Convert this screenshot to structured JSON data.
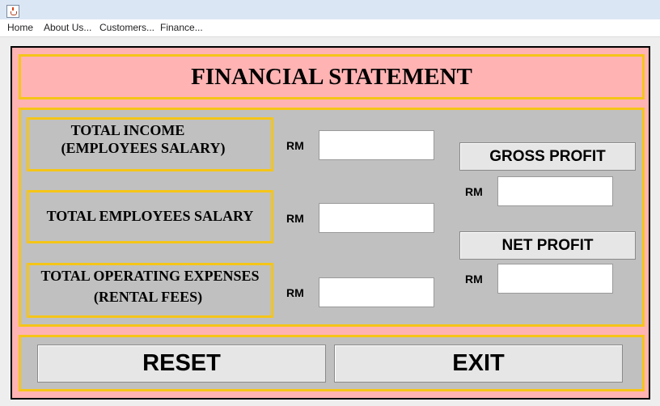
{
  "window": {
    "icon": "java-cup-icon"
  },
  "menu": {
    "items": [
      "Home",
      "About Us...",
      "Customers...",
      "Finance..."
    ]
  },
  "title": "FINANCIAL STATEMENT",
  "form": {
    "total_income": {
      "line1": "TOTAL INCOME",
      "line2": "(EMPLOYEES SALARY)",
      "currency": "RM",
      "value": ""
    },
    "total_salary": {
      "line1": "TOTAL EMPLOYEES SALARY",
      "currency": "RM",
      "value": ""
    },
    "operating_expenses": {
      "line1": "TOTAL OPERATING EXPENSES",
      "line2": "(RENTAL FEES)",
      "currency": "RM",
      "value": ""
    },
    "gross_profit": {
      "label": "GROSS PROFIT",
      "currency": "RM",
      "value": ""
    },
    "net_profit": {
      "label": "NET PROFIT",
      "currency": "RM",
      "value": ""
    }
  },
  "buttons": {
    "reset": "RESET",
    "exit": "EXIT"
  },
  "colors": {
    "background": "#ffb3b3",
    "panel": "#c0c0c0",
    "border_accent": "#f5c518"
  }
}
